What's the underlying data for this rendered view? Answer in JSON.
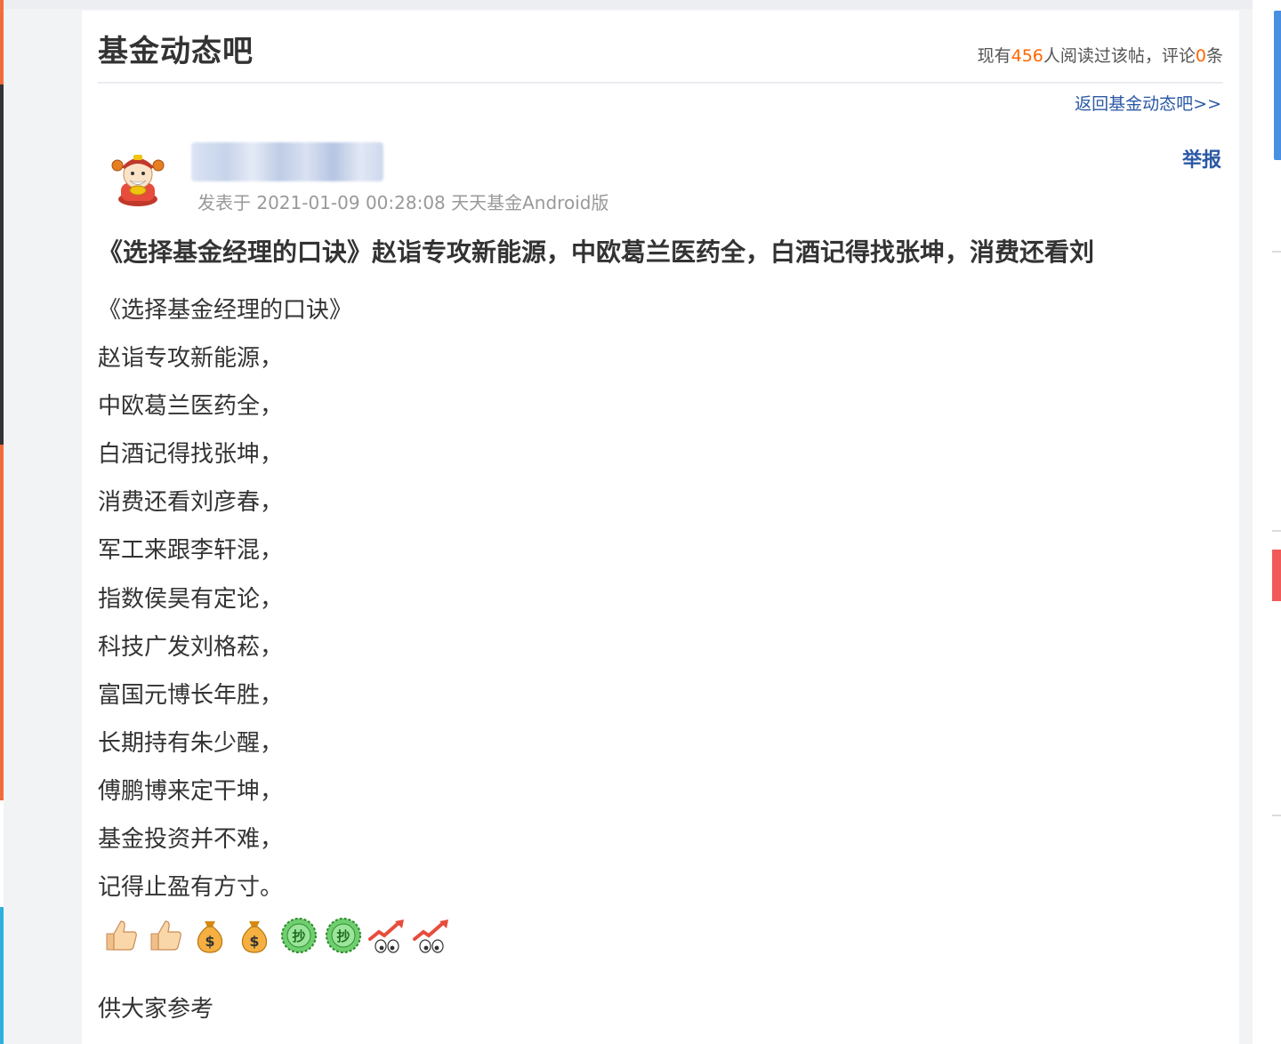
{
  "bar": {
    "title": "基金动态吧",
    "stats": {
      "prefix": "现有",
      "readers": "456",
      "mid": "人阅读过该帖，评论",
      "comments": "0",
      "suffix": "条"
    },
    "back_link": "返回基金动态吧>>"
  },
  "post": {
    "author_name": "",
    "meta": "发表于 2021-01-09 00:28:08 天天基金Android版",
    "report_label": "举报",
    "title": "《选择基金经理的口诀》赵诣专攻新能源，中欧葛兰医药全，白酒记得找张坤，消费还看刘",
    "lines": [
      "《选择基金经理的口诀》",
      "赵诣专攻新能源，",
      "中欧葛兰医药全，",
      "白酒记得找张坤，",
      "消费还看刘彦春，",
      "军工来跟李轩混，",
      "指数侯昊有定论，",
      "科技广发刘格菘，",
      "富国元博长年胜，",
      "长期持有朱少醒，",
      "傅鹏博来定干坤，",
      "基金投资并不难，",
      "记得止盈有方寸。"
    ],
    "emojis": [
      "thumbs-up-icon",
      "thumbs-up-icon",
      "money-bag-icon",
      "money-bag-icon",
      "chao-coin-icon",
      "chao-coin-icon",
      "rising-chart-eyes-icon",
      "rising-chart-eyes-icon"
    ],
    "closing": "供大家参考"
  },
  "colors": {
    "accent_link": "#2b59a5",
    "highlight": "#ff6600",
    "side_blue": "#4a90e2",
    "side_red": "#f25a5a"
  }
}
